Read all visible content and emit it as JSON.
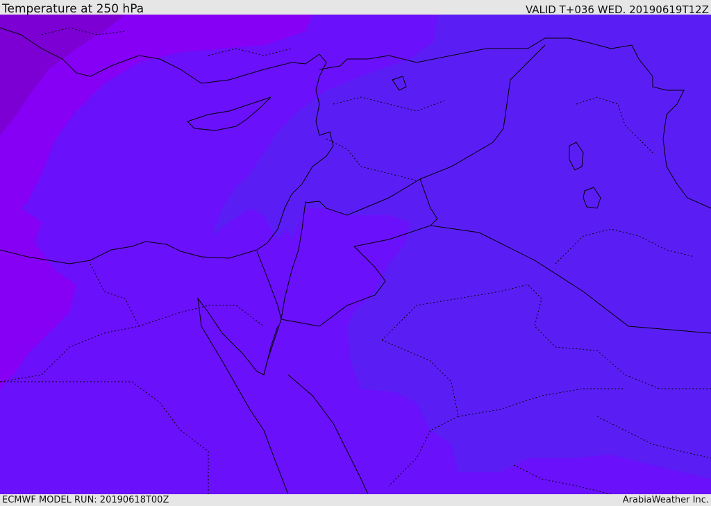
{
  "header": {
    "title": "Temperature at 250 hPa",
    "valid_time": "VALID T+036 WED. 20190619T12Z"
  },
  "footer": {
    "model_run": "ECMWF MODEL RUN: 20190618T00Z",
    "credit": "ArabiaWeather Inc."
  },
  "colors": {
    "base": "#5a1ef5",
    "warm_band": "#6a10fb",
    "violet": "#8600f5",
    "deep_violet": "#7c00d4",
    "land_east": "#5a1ef5",
    "border_line": "#000000"
  },
  "map": {
    "field": "temperature",
    "level": "250 hPa",
    "region": "Eastern Mediterranean / Middle East"
  }
}
